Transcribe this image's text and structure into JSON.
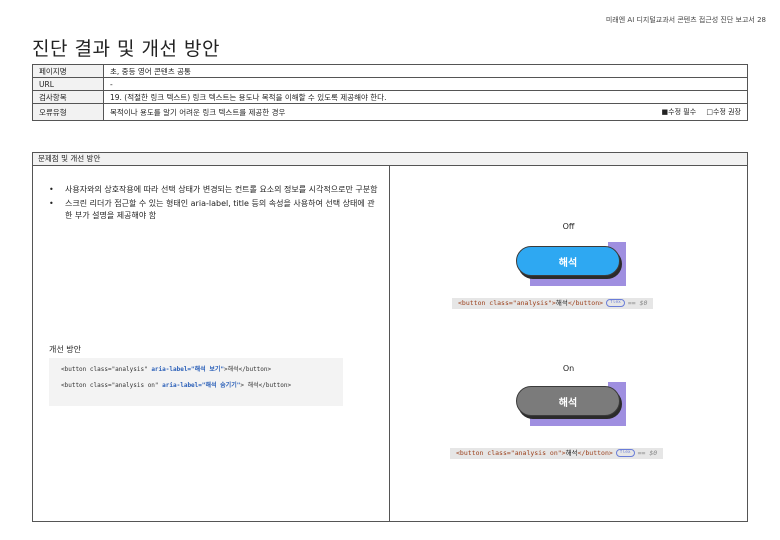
{
  "doc": {
    "header_note": "미래엔 AI 디지털교과서 콘텐츠 접근성 진단 보고서  28",
    "title": "진단 결과 및 개선 방안"
  },
  "info": {
    "page_label": "페이지명",
    "page_value": "초, 중등 영어 콘텐츠 공통",
    "url_label": "URL",
    "url_value": "-",
    "check_label": "검사항목",
    "check_value": "19. (적절한 링크 텍스트) 링크 텍스트는 용도나 목적을 이해할 수 있도록 제공해야 한다.",
    "error_label": "오류유형",
    "error_value": "목적이나 용도를 알기 어려운 링크 텍스트를 제공한 경우",
    "legend_required": "■수정 필수",
    "legend_recommended": "□수정 권장"
  },
  "section": {
    "header": "문제점 및 개선 방안",
    "bullets": [
      "사용자와의 상호작용에 따라 선택 상태가 변경되는 컨트롤 요소의 정보를 시각적으로만 구분함",
      "스크린 리더가 접근할 수 있는 형태인 aria-label, title 등의 속성을 사용하여 선택 상태에 관한 부가 설명을 제공해야 함"
    ],
    "bullet_symbol": "•",
    "improve_label": "개선 방안",
    "code1_pre": "<button class=\"analysis\" ",
    "code1_attr": "aria-label=\"해석 보기\"",
    "code1_post": ">해석</button>",
    "code2_pre": "<button class=\"analysis on\" ",
    "code2_attr": "aria-label=\"해석 숨기기\"",
    "code2_post": "> 해석</button>"
  },
  "examples": {
    "off_label": "Off",
    "on_label": "On",
    "button_text": "해석",
    "off_snippet_open": "<button class=\"analysis\">",
    "off_snippet_text": "해석",
    "off_snippet_close": "</button>",
    "on_snippet_open": "<button class=\"analysis on\">",
    "on_snippet_text": "해석",
    "on_snippet_close": "</button>",
    "badge": "flex",
    "eq": "== $0"
  },
  "colors": {
    "off_button": "#2ea8f2",
    "on_button": "#7b7b7b",
    "highlight": "#9f8fe0",
    "attr_blue": "#2a5fb8"
  }
}
